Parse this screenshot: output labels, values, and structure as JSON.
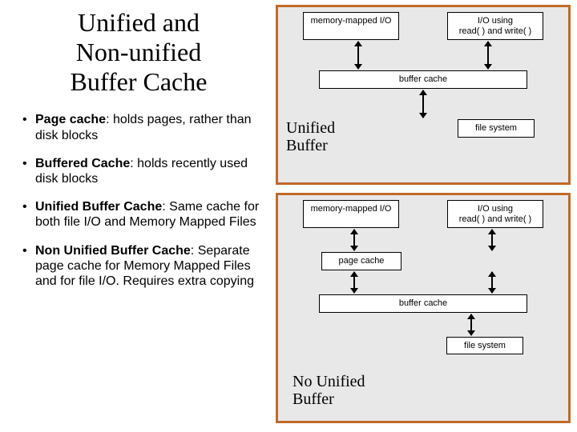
{
  "title_lines": [
    "Unified and",
    "Non-unified",
    "Buffer Cache"
  ],
  "bullets": [
    {
      "term": "Page cache",
      "rest": ": holds pages, rather than disk blocks"
    },
    {
      "term": "Buffered Cache",
      "rest": ": holds recently used disk blocks"
    },
    {
      "term": "Unified Buffer Cache",
      "rest": ": Same cache for both file I/O and Memory Mapped Files"
    },
    {
      "term": "Non Unified Buffer Cache",
      "rest": ": Separate page cache for Memory Mapped Files and for file I/O. Requires extra copying"
    }
  ],
  "diagram": {
    "mmio": "memory-mapped I/O",
    "io_rw": "I/O using\nread( ) and write( )",
    "buffer_cache": "buffer cache",
    "page_cache": "page cache",
    "file_system": "file system",
    "caption_unified": "Unified Buffer",
    "caption_nounified": "No Unified Buffer"
  }
}
